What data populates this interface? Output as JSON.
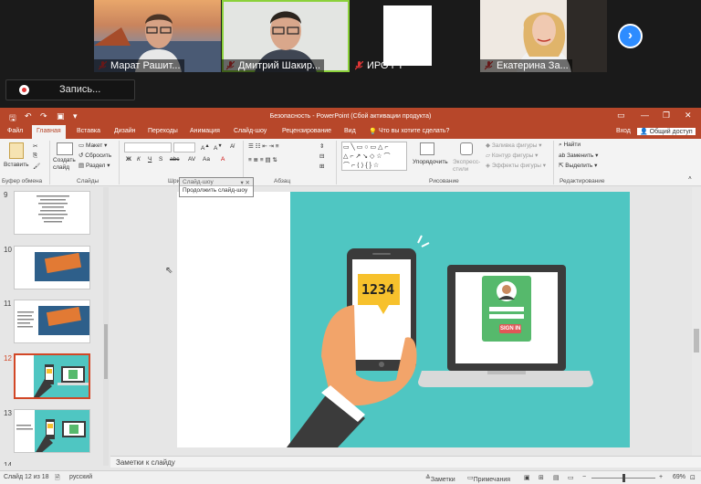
{
  "zoom": {
    "participants": [
      {
        "name": "Марат Рашит..."
      },
      {
        "name": "Дмитрий Шакир..."
      },
      {
        "name": "ИРО РТ"
      },
      {
        "name": "Екатерина За..."
      }
    ],
    "record_label": "Запись...",
    "next_icon": "chevron-right-icon"
  },
  "app": {
    "title": "Безопасность - PowerPoint (Сбой активации продукта)",
    "tabs": [
      "Файл",
      "Главная",
      "Вставка",
      "Дизайн",
      "Переходы",
      "Анимация",
      "Слайд-шоу",
      "Рецензирование",
      "Вид"
    ],
    "active_tab": "Главная",
    "tell_me": "Что вы хотите сделать?",
    "sign_in": "Вход",
    "share": "Общий доступ"
  },
  "ribbon": {
    "paste": "Вставить",
    "clipboard_group": "Буфер обмена",
    "new_slide": "Создать слайд",
    "layout": "Макет",
    "reset": "Сбросить",
    "section": "Раздел",
    "slides_group": "Слайды",
    "font_group": "Шрифт",
    "paragraph_group": "Абзац",
    "arrange": "Упорядочить",
    "quick_styles": "Экспресс-стили",
    "fill": "Заливка фигуры",
    "outline": "Контур фигуры",
    "effects": "Эффекты фигуры",
    "drawing_group": "Рисование",
    "find": "Найти",
    "replace": "Заменить",
    "select": "Выделить",
    "editing_group": "Редактирование"
  },
  "tooltip": {
    "header": "Слайд-шоу",
    "action": "Продолжить слайд-шоу"
  },
  "thumbnails": [
    {
      "num": "9"
    },
    {
      "num": "10"
    },
    {
      "num": "11"
    },
    {
      "num": "12"
    },
    {
      "num": "13"
    },
    {
      "num": "14"
    }
  ],
  "slide": {
    "pin_code": "1234",
    "login_button": "SIGN IN",
    "colors": {
      "background": "#4fc6c2",
      "phone_bubble": "#f7c12c",
      "login_card": "#56b96c",
      "sign_in": "#e05757",
      "hand": "#f2a46a",
      "sleeve": "#3b3b3b"
    }
  },
  "notes_placeholder": "Заметки к слайду",
  "status": {
    "slide_info": "Слайд 12 из 18",
    "language": "русский",
    "notes": "Заметки",
    "comments": "Примечания",
    "zoom": "69%"
  }
}
